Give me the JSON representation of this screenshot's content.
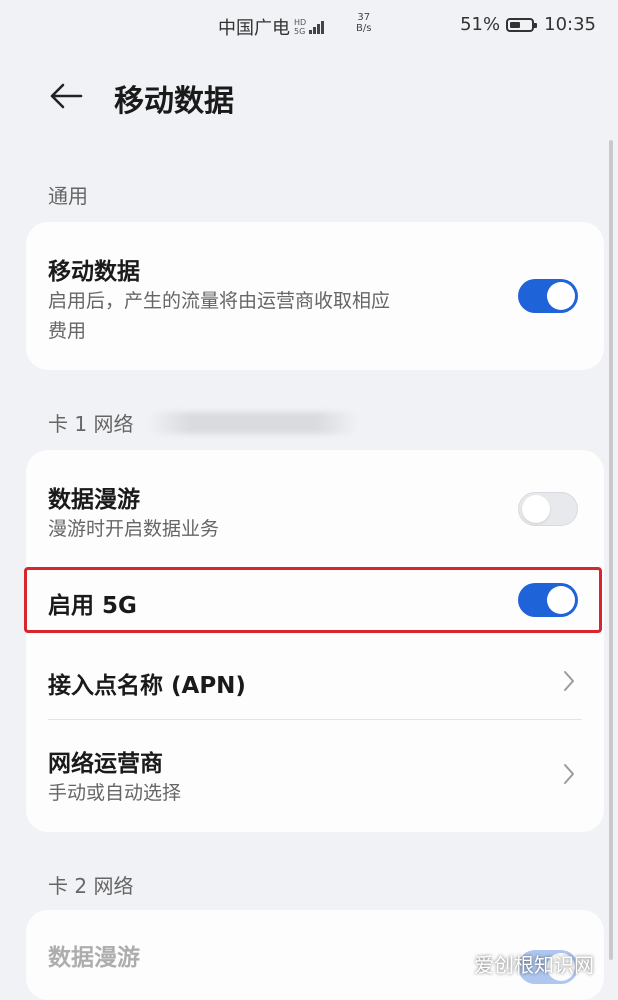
{
  "status_bar": {
    "carrier": "中国广电",
    "network_type_top": "HD",
    "network_type_bottom": "5G",
    "speed_value": "37",
    "speed_unit": "B/s",
    "battery_percent": "51%",
    "battery_level": 0.51,
    "time": "10:35"
  },
  "header": {
    "title": "移动数据",
    "back_icon": "arrow-left-icon"
  },
  "sections": {
    "general": {
      "label": "通用",
      "mobile_data": {
        "title": "移动数据",
        "subtitle_line1": "启用后，产生的流量将由运营商收取相应",
        "subtitle_line2": "费用",
        "enabled": true
      }
    },
    "sim1": {
      "label": "卡 1 网络",
      "data_roaming": {
        "title": "数据漫游",
        "subtitle": "漫游时开启数据业务",
        "enabled": false
      },
      "enable_5g": {
        "title": "启用 5G",
        "enabled": true
      },
      "apn": {
        "title": "接入点名称 (APN)",
        "icon": "chevron-right-icon"
      },
      "operator": {
        "title": "网络运营商",
        "subtitle": "手动或自动选择",
        "icon": "chevron-right-icon"
      }
    },
    "sim2": {
      "label": "卡 2 网络",
      "data_roaming": {
        "title": "数据漫游"
      }
    }
  },
  "watermark": "爱创根知识网",
  "colors": {
    "accent": "#1f63d8",
    "highlight": "#d7262e",
    "background": "#f1f2f5"
  }
}
